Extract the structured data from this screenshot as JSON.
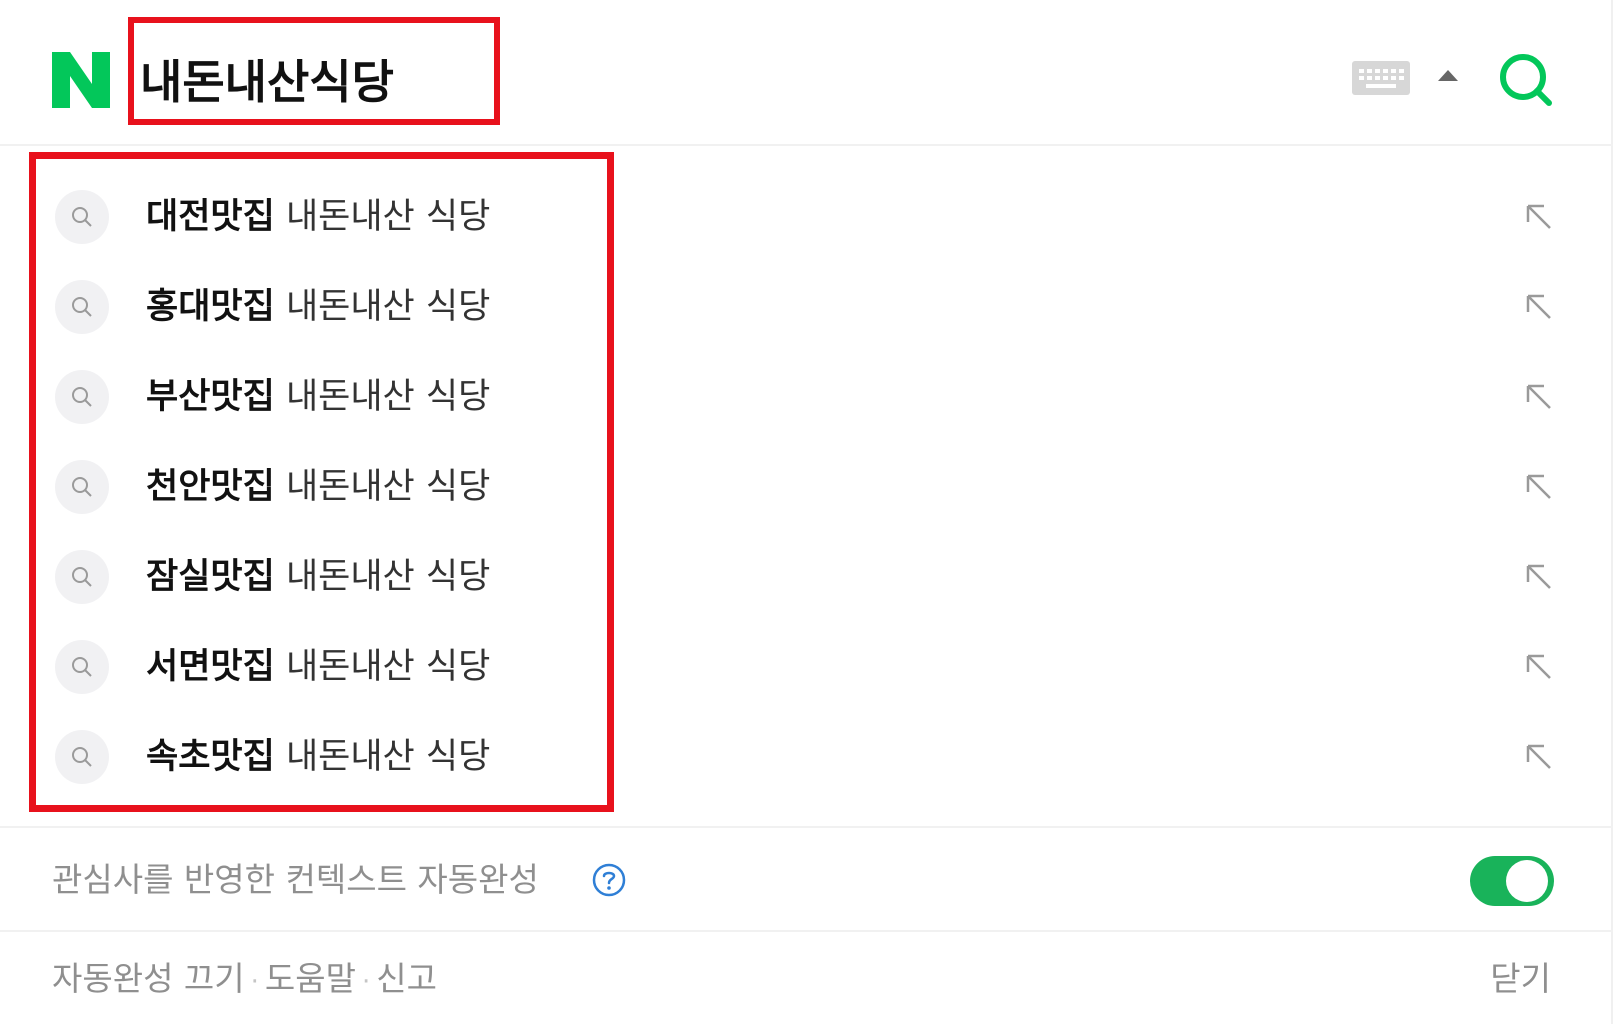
{
  "search": {
    "query": "내돈내산식당",
    "logo_letter": "N"
  },
  "colors": {
    "brand_green": "#03c75a",
    "highlight_red": "#e8111c",
    "toggle_on": "#19b35a",
    "help_blue": "#2f7fd6"
  },
  "icons": {
    "logo": "naver-n-logo",
    "keyboard": "keyboard-icon",
    "collapse": "caret-up-icon",
    "search": "search-icon",
    "suggestion": "magnifier-icon",
    "fill": "arrow-up-left-icon",
    "help": "question-circle-icon"
  },
  "suggestions": [
    {
      "bold": "대전맛집",
      "rest": " 내돈내산 식당"
    },
    {
      "bold": "홍대맛집",
      "rest": " 내돈내산 식당"
    },
    {
      "bold": "부산맛집",
      "rest": " 내돈내산 식당"
    },
    {
      "bold": "천안맛집",
      "rest": " 내돈내산 식당"
    },
    {
      "bold": "잠실맛집",
      "rest": " 내돈내산 식당"
    },
    {
      "bold": "서면맛집",
      "rest": " 내돈내산 식당"
    },
    {
      "bold": "속초맛집",
      "rest": " 내돈내산 식당"
    }
  ],
  "context": {
    "label": "관심사를 반영한 컨텍스트 자동완성",
    "enabled": true
  },
  "footer": {
    "autocomplete_off": "자동완성 끄기",
    "help": "도움말",
    "report": "신고",
    "separator": "·",
    "close": "닫기"
  }
}
